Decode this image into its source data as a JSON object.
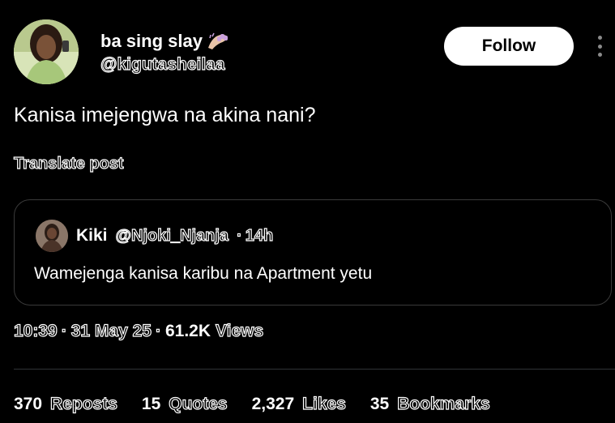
{
  "author": {
    "display_name": "ba sing slay",
    "handle": "@kigutasheilaa",
    "avatar_icon": "profile-photo"
  },
  "follow_label": "Follow",
  "post": {
    "text": "Kanisa imejengwa na akina nani?",
    "translate_label": "Translate post"
  },
  "quote": {
    "name": "Kiki",
    "handle": "@Njoki_Njanja",
    "separator": "·",
    "time": "14h",
    "text": "Wamejenga kanisa karibu na Apartment yetu"
  },
  "meta": {
    "time": "10:39",
    "separator": "·",
    "date": "31 May 25",
    "views_count": "61.2K",
    "views_label": "Views"
  },
  "stats": [
    {
      "count": "370",
      "label": "Reposts"
    },
    {
      "count": "15",
      "label": "Quotes"
    },
    {
      "count": "2,327",
      "label": "Likes"
    },
    {
      "count": "35",
      "label": "Bookmarks"
    }
  ],
  "colors": {
    "background": "#000000",
    "text": "#ffffff",
    "follow_bg": "#ffffff",
    "border": "#3a3a3a",
    "emoji_nail": "#c9a0dc"
  }
}
